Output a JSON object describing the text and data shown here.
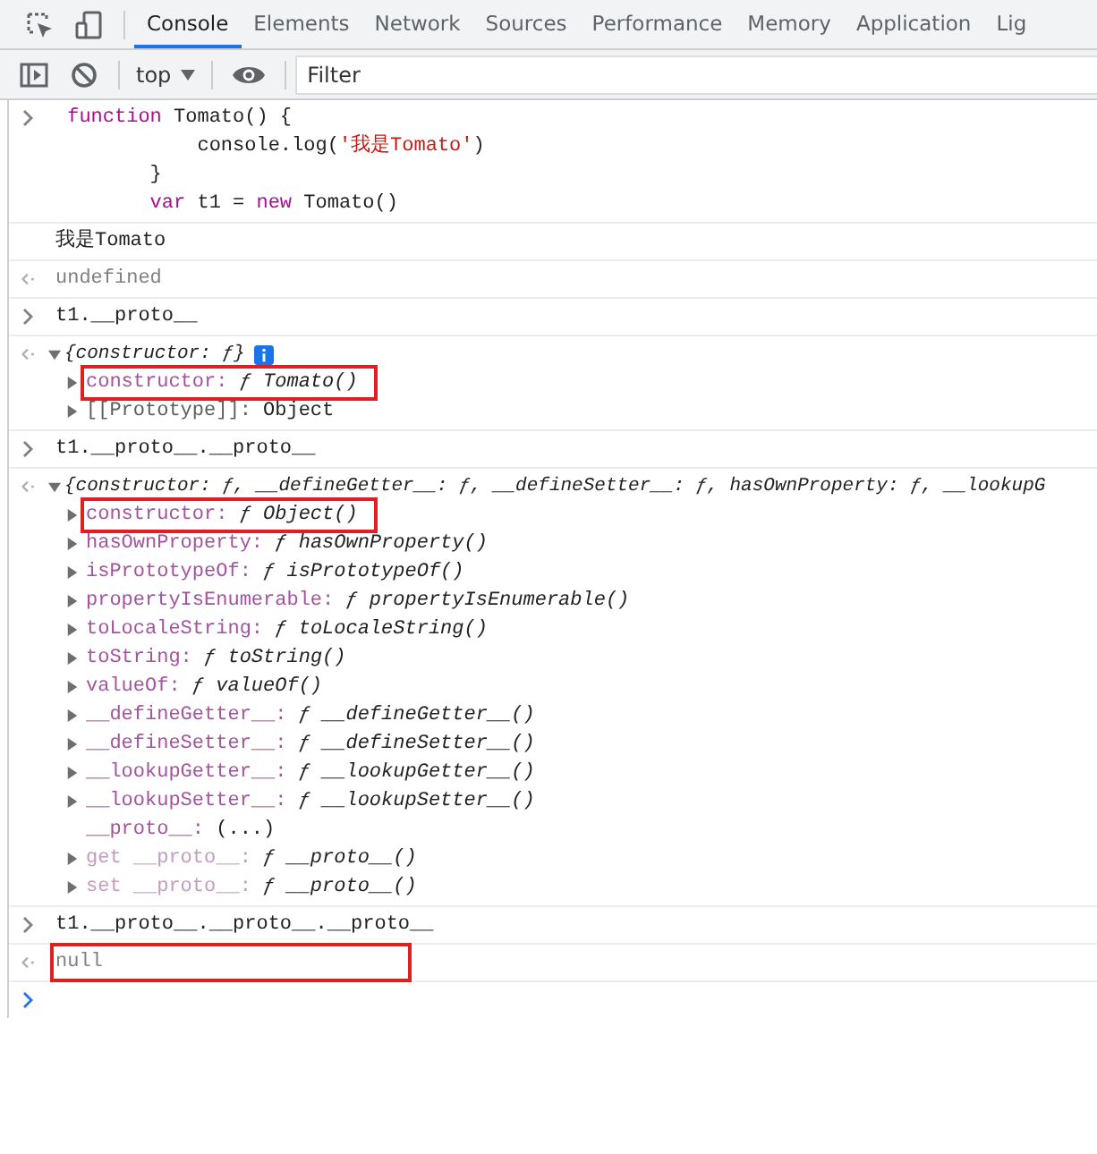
{
  "tabs": [
    {
      "label": "Console",
      "selected": true
    },
    {
      "label": "Elements",
      "selected": false
    },
    {
      "label": "Network",
      "selected": false
    },
    {
      "label": "Sources",
      "selected": false
    },
    {
      "label": "Performance",
      "selected": false
    },
    {
      "label": "Memory",
      "selected": false
    },
    {
      "label": "Application",
      "selected": false
    },
    {
      "label": "Lig",
      "selected": false
    }
  ],
  "console_toolbar": {
    "context": "top",
    "filter": {
      "placeholder": "Filter"
    }
  },
  "entries": [
    {
      "kind": "input",
      "lines": [
        [
          {
            "text": " function",
            "kind": "keyword"
          },
          {
            "text": " Tomato() {",
            "kind": "plain"
          }
        ],
        [
          {
            "text": "            console.log(",
            "kind": "plain"
          },
          {
            "text": "'我是Tomato'",
            "kind": "string"
          },
          {
            "text": ")",
            "kind": "plain"
          }
        ],
        [
          {
            "text": "        }",
            "kind": "plain"
          }
        ],
        [
          {
            "text": "        var",
            "kind": "keyword"
          },
          {
            "text": " t1 = ",
            "kind": "plain"
          },
          {
            "text": "new",
            "kind": "keyword"
          },
          {
            "text": " Tomato()",
            "kind": "plain"
          }
        ]
      ]
    },
    {
      "kind": "log",
      "text": "我是Tomato"
    },
    {
      "kind": "result",
      "text": "undefined",
      "highlighted": false
    },
    {
      "kind": "input",
      "lines": [
        [
          {
            "text": "t1.__proto__",
            "kind": "plain"
          }
        ]
      ]
    },
    {
      "kind": "object",
      "summary": "{constructor: ƒ}",
      "expanded": true,
      "info": true,
      "properties": [
        {
          "name": "constructor:",
          "value": "ƒ Tomato()",
          "kind": "method",
          "expandable": true,
          "highlighted": true
        },
        {
          "name": "[[Prototype]]:",
          "value": "Object",
          "kind": "internal",
          "expandable": true,
          "highlighted": false
        }
      ]
    },
    {
      "kind": "input",
      "lines": [
        [
          {
            "text": "t1.__proto__.__proto__",
            "kind": "plain"
          }
        ]
      ]
    },
    {
      "kind": "object",
      "summary": "{constructor: ƒ, __defineGetter__: ƒ, __defineSetter__: ƒ, hasOwnProperty: ƒ, __lookupG",
      "expanded": true,
      "info": false,
      "properties": [
        {
          "name": "constructor:",
          "value": "ƒ Object()",
          "kind": "method",
          "expandable": true,
          "highlighted": true
        },
        {
          "name": "hasOwnProperty:",
          "value": "ƒ hasOwnProperty()",
          "kind": "method",
          "expandable": true,
          "highlighted": false
        },
        {
          "name": "isPrototypeOf:",
          "value": "ƒ isPrototypeOf()",
          "kind": "method",
          "expandable": true,
          "highlighted": false
        },
        {
          "name": "propertyIsEnumerable:",
          "value": "ƒ propertyIsEnumerable()",
          "kind": "method",
          "expandable": true,
          "highlighted": false
        },
        {
          "name": "toLocaleString:",
          "value": "ƒ toLocaleString()",
          "kind": "method",
          "expandable": true,
          "highlighted": false
        },
        {
          "name": "toString:",
          "value": "ƒ toString()",
          "kind": "method",
          "expandable": true,
          "highlighted": false
        },
        {
          "name": "valueOf:",
          "value": "ƒ valueOf()",
          "kind": "method",
          "expandable": true,
          "highlighted": false
        },
        {
          "name": "__defineGetter__:",
          "value": "ƒ __defineGetter__()",
          "kind": "method",
          "expandable": true,
          "highlighted": false
        },
        {
          "name": "__defineSetter__:",
          "value": "ƒ __defineSetter__()",
          "kind": "method",
          "expandable": true,
          "highlighted": false
        },
        {
          "name": "__lookupGetter__:",
          "value": "ƒ __lookupGetter__()",
          "kind": "method",
          "expandable": true,
          "highlighted": false
        },
        {
          "name": "__lookupSetter__:",
          "value": "ƒ __lookupSetter__()",
          "kind": "method",
          "expandable": true,
          "highlighted": false
        },
        {
          "name": "__proto__:",
          "value": "(...)",
          "kind": "lazy",
          "expandable": false,
          "highlighted": false
        },
        {
          "name": "get __proto__:",
          "value": "ƒ __proto__()",
          "kind": "accessor",
          "expandable": true,
          "highlighted": false
        },
        {
          "name": "set __proto__:",
          "value": "ƒ __proto__()",
          "kind": "accessor",
          "expandable": true,
          "highlighted": false
        }
      ]
    },
    {
      "kind": "input",
      "lines": [
        [
          {
            "text": "t1.__proto__.__proto__.__proto__",
            "kind": "plain"
          }
        ]
      ]
    },
    {
      "kind": "result",
      "text": "null",
      "highlighted": true
    },
    {
      "kind": "prompt"
    }
  ]
}
